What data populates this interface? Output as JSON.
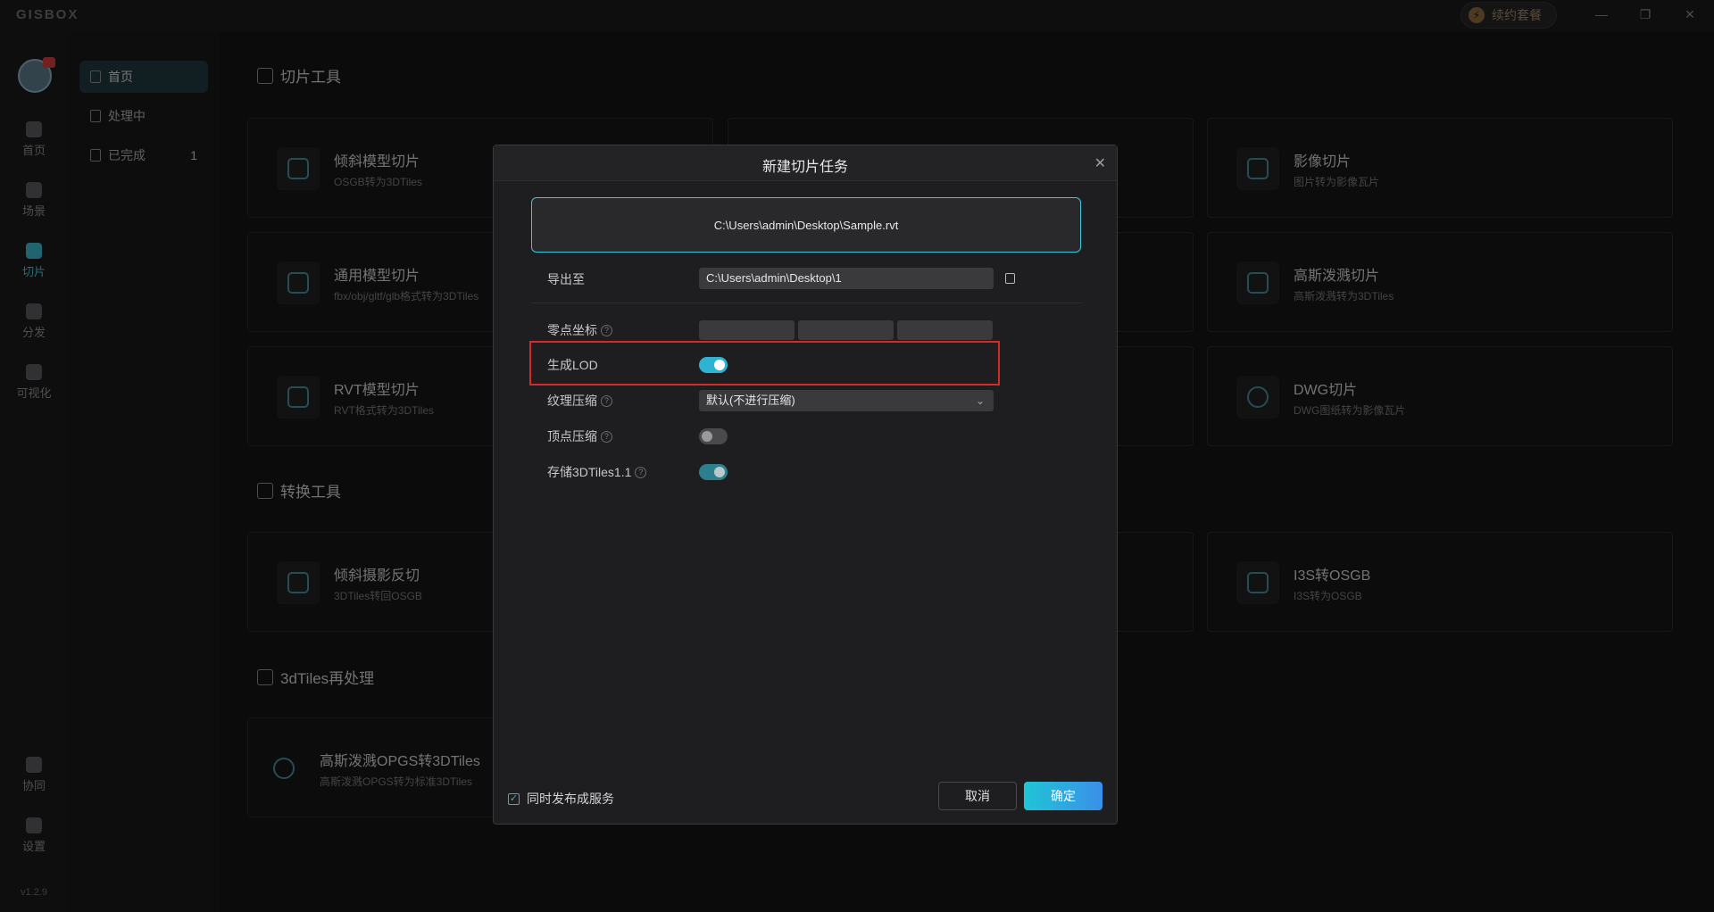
{
  "app": {
    "logo": "GISBOX",
    "vip_label": "续约套餐"
  },
  "window_controls": {
    "minimize": "—",
    "restore": "❐",
    "close": "✕"
  },
  "left_rail": {
    "items": [
      {
        "label": "首页",
        "icon": "home-icon"
      },
      {
        "label": "场景",
        "icon": "scene-icon"
      },
      {
        "label": "切片",
        "icon": "slice-icon",
        "active": true
      },
      {
        "label": "分发",
        "icon": "distribute-icon"
      },
      {
        "label": "可视化",
        "icon": "visualize-icon"
      }
    ],
    "bottom_items": [
      {
        "label": "协同",
        "icon": "collab-icon"
      },
      {
        "label": "设置",
        "icon": "settings-icon"
      }
    ],
    "version": "v1.2.9"
  },
  "sub_nav": {
    "items": [
      {
        "label": "首页",
        "active": true
      },
      {
        "label": "处理中"
      },
      {
        "label": "已完成",
        "count": "1"
      }
    ]
  },
  "sections": {
    "slice_tools": "切片工具",
    "convert_tools": "转换工具",
    "reprocess": "3dTiles再处理"
  },
  "cards": [
    {
      "title": "倾斜模型切片",
      "subtitle": "OSGB转为3DTiles"
    },
    {
      "title": "影像切片",
      "subtitle": "图片转为影像瓦片"
    },
    {
      "title": "通用模型切片",
      "subtitle": "fbx/obj/gltf/glb格式转为3DTiles"
    },
    {
      "title": "高斯泼溅切片",
      "subtitle": "高斯泼溅转为3DTiles"
    },
    {
      "title": "RVT模型切片",
      "subtitle": "RVT格式转为3DTiles"
    },
    {
      "title": "DWG切片",
      "subtitle": "DWG图纸转为影像瓦片"
    },
    {
      "title": "倾斜摄影反切",
      "subtitle": "3DTiles转回OSGB"
    },
    {
      "title": "I3S转OSGB",
      "subtitle": "I3S转为OSGB"
    },
    {
      "title": "高斯泼溅OPGS转3DTiles",
      "subtitle": "高斯泼溅OPGS转为标准3DTiles"
    }
  ],
  "dialog": {
    "title": "新建切片任务",
    "close": "✕",
    "file_path": "C:\\Users\\admin\\Desktop\\Sample.rvt",
    "export_label": "导出至",
    "export_path": "C:\\Users\\admin\\Desktop\\1",
    "origin_label": "零点坐标",
    "lod_label": "生成LOD",
    "lod_enabled": true,
    "texture_label": "纹理压缩",
    "texture_value": "默认(不进行压缩)",
    "vertex_label": "顶点压缩",
    "vertex_enabled": false,
    "store_label": "存储3DTiles1.1",
    "store_enabled": true,
    "help_mark": "?",
    "publish_label": "同时发布成服务",
    "publish_checked": true,
    "checkmark": "✓",
    "cancel_label": "取消",
    "ok_label": "确定",
    "accent_color": "#2fb3d2",
    "highlight_color": "#d42a2a"
  }
}
